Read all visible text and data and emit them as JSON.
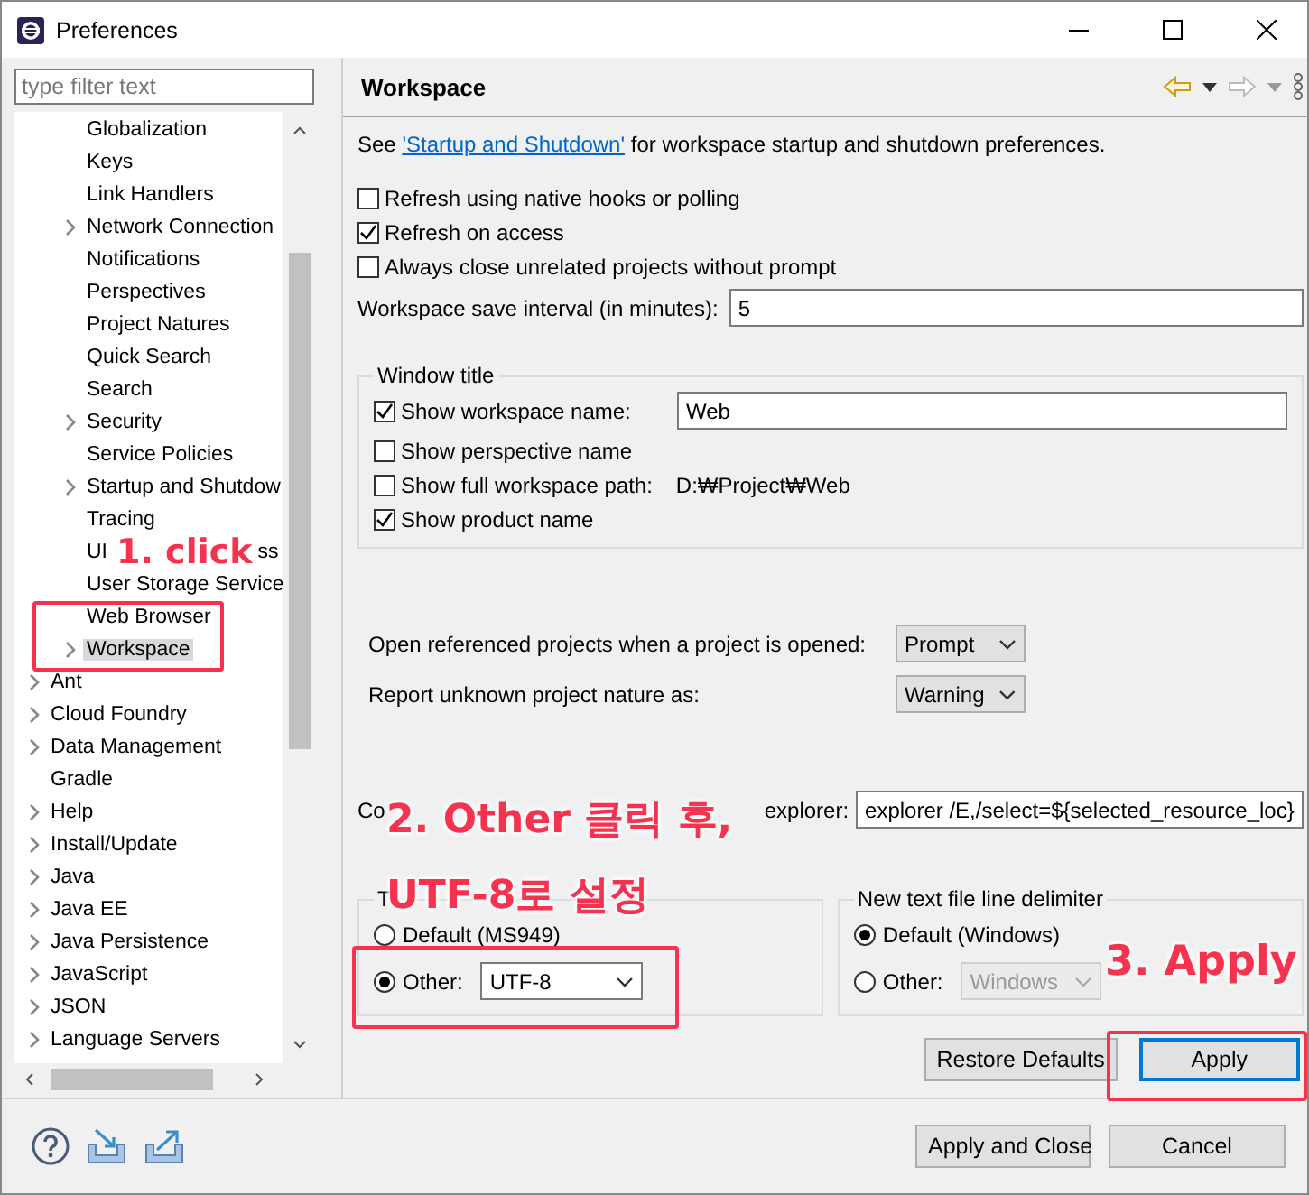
{
  "window": {
    "title": "Preferences"
  },
  "filter": {
    "placeholder": "type filter text"
  },
  "tree": {
    "nested_items": [
      {
        "label": "Globalization",
        "expandable": false,
        "selected": false
      },
      {
        "label": "Keys",
        "expandable": false,
        "selected": false
      },
      {
        "label": "Link Handlers",
        "expandable": false,
        "selected": false
      },
      {
        "label": "Network Connection",
        "expandable": true,
        "selected": false
      },
      {
        "label": "Notifications",
        "expandable": false,
        "selected": false
      },
      {
        "label": "Perspectives",
        "expandable": false,
        "selected": false
      },
      {
        "label": "Project Natures",
        "expandable": false,
        "selected": false
      },
      {
        "label": "Quick Search",
        "expandable": false,
        "selected": false
      },
      {
        "label": "Search",
        "expandable": false,
        "selected": false
      },
      {
        "label": "Security",
        "expandable": true,
        "selected": false
      },
      {
        "label": "Service Policies",
        "expandable": false,
        "selected": false
      },
      {
        "label": "Startup and Shutdow",
        "expandable": true,
        "selected": false
      },
      {
        "label": "Tracing",
        "expandable": false,
        "selected": false
      },
      {
        "label": "UI",
        "tail": "ss",
        "expandable": false,
        "selected": false
      },
      {
        "label": "User Storage Service",
        "expandable": false,
        "selected": false
      },
      {
        "label": "Web Browser",
        "expandable": false,
        "selected": false
      },
      {
        "label": "Workspace",
        "expandable": true,
        "selected": true
      }
    ],
    "items": [
      {
        "label": "Ant",
        "expandable": true,
        "selected": false
      },
      {
        "label": "Cloud Foundry",
        "expandable": true,
        "selected": false
      },
      {
        "label": "Data Management",
        "expandable": true,
        "selected": false
      },
      {
        "label": "Gradle",
        "expandable": false,
        "selected": false
      },
      {
        "label": "Help",
        "expandable": true,
        "selected": false
      },
      {
        "label": "Install/Update",
        "expandable": true,
        "selected": false
      },
      {
        "label": "Java",
        "expandable": true,
        "selected": false
      },
      {
        "label": "Java EE",
        "expandable": true,
        "selected": false
      },
      {
        "label": "Java Persistence",
        "expandable": true,
        "selected": false
      },
      {
        "label": "JavaScript",
        "expandable": true,
        "selected": false
      },
      {
        "label": "JSON",
        "expandable": true,
        "selected": false
      },
      {
        "label": "Language Servers",
        "expandable": true,
        "selected": false
      }
    ]
  },
  "page": {
    "title": "Workspace",
    "intro": {
      "before": "See ",
      "link": "'Startup and Shutdown'",
      "after": " for workspace startup and shutdown preferences."
    },
    "options": [
      {
        "label": "Refresh using native hooks or polling",
        "checked": false
      },
      {
        "label": "Refresh on access",
        "checked": true
      },
      {
        "label": "Always close unrelated projects without prompt",
        "checked": false
      }
    ],
    "save_interval": {
      "label": "Workspace save interval (in minutes):",
      "value": "5"
    },
    "window_title": {
      "legend": "Window title",
      "show_workspace_name": {
        "label": "Show workspace name:",
        "checked": true,
        "value": "Web"
      },
      "show_perspective_name": {
        "label": "Show perspective name",
        "checked": false
      },
      "show_full_path": {
        "label": "Show full workspace path:",
        "checked": false,
        "path": "D:₩Project₩Web"
      },
      "show_product_name": {
        "label": "Show product name",
        "checked": true
      }
    },
    "open_referenced": {
      "label": "Open referenced projects when a project is opened:",
      "value": "Prompt"
    },
    "unknown_nature": {
      "label": "Report unknown project nature as:",
      "value": "Warning"
    },
    "command": {
      "label": "Co",
      "tail": "explorer:",
      "value": "explorer /E,/select=${selected_resource_loc}"
    },
    "encoding": {
      "legend": "T",
      "default_label": "Default (MS949)",
      "default_selected": false,
      "other_label": "Other:",
      "other_selected": true,
      "value": "UTF-8"
    },
    "delimiter": {
      "legend": "New text file line delimiter",
      "default_label": "Default (Windows)",
      "default_selected": true,
      "other_label": "Other:",
      "other_selected": false,
      "value": "Windows"
    },
    "buttons": [
      "Restore Defaults",
      "Apply"
    ]
  },
  "footer": {
    "buttons": [
      "Apply and Close",
      "Cancel"
    ]
  },
  "annotations": [
    {
      "text": "1. click",
      "kind": "step1"
    },
    {
      "text": "2. Other 클릭 후,",
      "kind": "step2a"
    },
    {
      "text": "UTF-8로 설정",
      "kind": "step2b"
    },
    {
      "text": "3. Apply",
      "kind": "step3"
    }
  ]
}
